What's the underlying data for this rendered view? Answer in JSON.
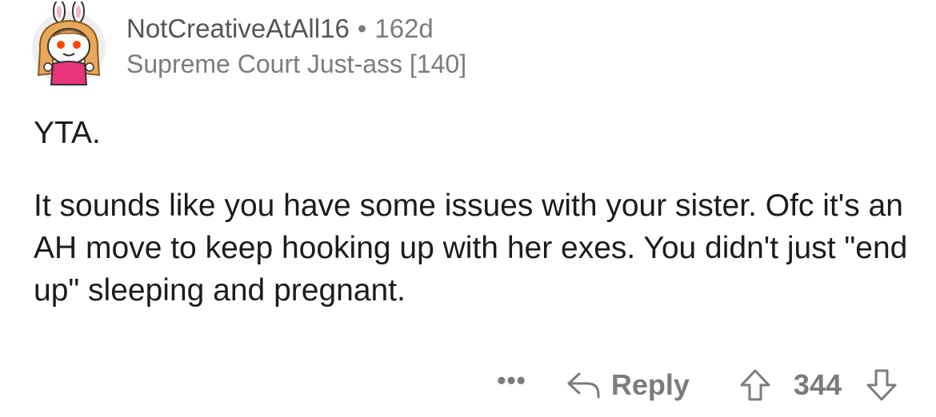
{
  "comment": {
    "username": "NotCreativeAtAll16",
    "separator": "•",
    "age": "162d",
    "flair": "Supreme Court Just-ass [140]",
    "paragraphs": [
      "YTA.",
      "It sounds like you have some issues with your sister. Ofc it's an AH move to keep hooking up with her exes. You didn't just \"end up\" sleeping and pregnant."
    ]
  },
  "actions": {
    "more_label": "•••",
    "reply_label": "Reply",
    "score": "344"
  },
  "icons": {
    "avatar": "snoo-avatar-icon",
    "reply": "reply-arrow-icon",
    "upvote": "upvote-arrow-icon",
    "downvote": "downvote-arrow-icon"
  },
  "colors": {
    "text": "#1c1c1c",
    "meta": "#7c7c7c",
    "avatar_shirt": "#e8347a",
    "avatar_hair": "#e9a75a"
  }
}
